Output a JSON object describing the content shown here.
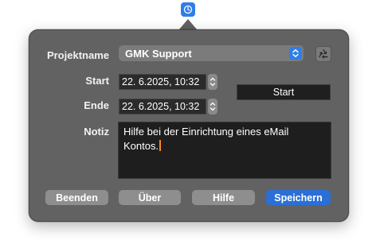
{
  "statusbar": {
    "icon": "timer-icon"
  },
  "form": {
    "project_label": "Projektname",
    "project_value": "GMK Support",
    "start_label": "Start",
    "start_value": "22. 6.2025, 10:32",
    "end_label": "Ende",
    "end_value": "22. 6.2025, 10:32",
    "start_button": "Start",
    "note_label": "Notiz",
    "note_text": "Hilfe bei der Einrichtung eines eMail Kontos."
  },
  "buttons": {
    "quit": "Beenden",
    "about": "Über",
    "help": "Hilfe",
    "save": "Speichern"
  },
  "colors": {
    "accent": "#2a6fd6",
    "panel": "#626262",
    "field": "#2b2b2b",
    "caret": "#f08a2b"
  }
}
